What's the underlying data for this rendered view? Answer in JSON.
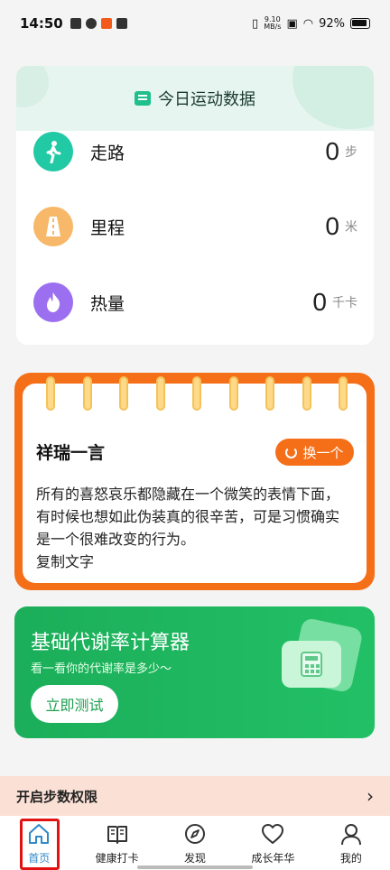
{
  "status_bar": {
    "time": "14:50",
    "net_speed_value": "9.10",
    "net_speed_unit": "MB/s",
    "battery": "92%"
  },
  "stats": {
    "title": "今日运动数据",
    "rows": [
      {
        "label": "走路",
        "value": "0",
        "unit": "步",
        "icon": "walk-icon",
        "color": "#21c9a4"
      },
      {
        "label": "里程",
        "value": "0",
        "unit": "米",
        "icon": "road-icon",
        "color": "#f7b869"
      },
      {
        "label": "热量",
        "value": "0",
        "unit": "千卡",
        "icon": "flame-icon",
        "color": "#9c6ff0"
      }
    ]
  },
  "quote_card": {
    "title": "祥瑞一言",
    "swap_label": "换一个",
    "text": "所有的喜怒哀乐都隐藏在一个微笑的表情下面，有时候也想如此伪装真的很辛苦，可是习惯确实是一个很难改变的行为。",
    "copy_label": "复制文字"
  },
  "metabolism": {
    "title": "基础代谢率计算器",
    "subtitle": "看一看你的代谢率是多少～",
    "button": "立即测试"
  },
  "permission_banner": {
    "label": "开启步数权限"
  },
  "nav": {
    "items": [
      {
        "label": "首页",
        "icon": "home-icon"
      },
      {
        "label": "健康打卡",
        "icon": "book-icon"
      },
      {
        "label": "发现",
        "icon": "compass-icon"
      },
      {
        "label": "成长年华",
        "icon": "heart-icon"
      },
      {
        "label": "我的",
        "icon": "user-icon"
      }
    ]
  },
  "colors": {
    "accent_orange": "#f56f19",
    "accent_green": "#1cae5a",
    "nav_active": "#2e89c9"
  }
}
